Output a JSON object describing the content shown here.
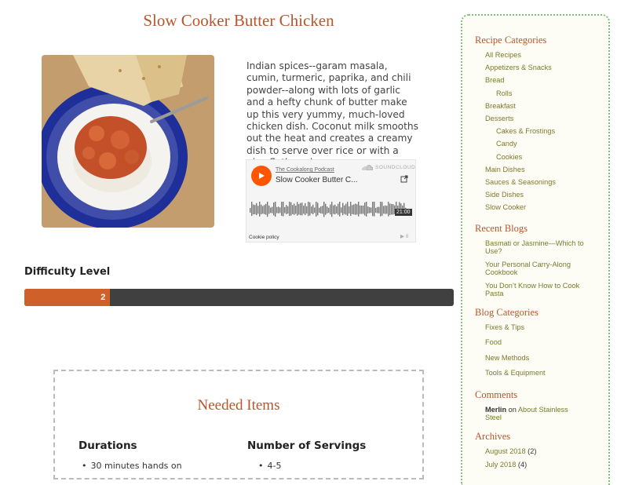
{
  "recipe": {
    "title": "Slow Cooker Butter Chicken",
    "description": "Indian spices--garam masala, cumin, turmeric, paprika, and chili powder--along with lots of garlic and a hefty chunk of butter make up this very yummy, much-loved chicken dish. Coconut milk smooths out the heat and creates a creamy dish to serve over rice or with a nice flatbread."
  },
  "player": {
    "artist": "The Cookalong Podcast",
    "track": "Slow Cooker Butter C...",
    "brand": "SOUNDCLOUD",
    "duration": "21:00",
    "cookie_policy": "Cookie policy",
    "stats": "8",
    "accent_color": "#ff5500"
  },
  "difficulty": {
    "label": "Difficulty Level",
    "value": "2",
    "fraction": 0.2,
    "fill_color": "#d0602a"
  },
  "needed": {
    "title": "Needed Items",
    "durations_heading": "Durations",
    "durations": [
      "30 minutes hands on"
    ],
    "servings_heading": "Number of Servings",
    "servings": [
      "4-5"
    ]
  },
  "sidebar": {
    "recipe_categories_heading": "Recipe Categories",
    "recipe_categories": [
      {
        "label": "All Recipes",
        "indent": 0
      },
      {
        "label": "Appetizers & Snacks",
        "indent": 0
      },
      {
        "label": "Bread",
        "indent": 0
      },
      {
        "label": "Rolls",
        "indent": 1
      },
      {
        "label": "Breakfast",
        "indent": 0
      },
      {
        "label": "Desserts",
        "indent": 0
      },
      {
        "label": "Cakes & Frostings",
        "indent": 1
      },
      {
        "label": "Candy",
        "indent": 1
      },
      {
        "label": "Cookies",
        "indent": 1
      },
      {
        "label": "Main Dishes",
        "indent": 0
      },
      {
        "label": "Sauces & Seasonings",
        "indent": 0
      },
      {
        "label": "Side Dishes",
        "indent": 0
      },
      {
        "label": "Slow Cooker",
        "indent": 0
      }
    ],
    "recent_blogs_heading": "Recent Blogs",
    "recent_blogs": [
      [
        "Basmati or Jasmine—Which to",
        "Use?"
      ],
      [
        "Your Personal Carry-Along",
        "Cookbook"
      ],
      [
        "You Don’t Know How to Cook",
        "Pasta"
      ]
    ],
    "blog_categories_heading": "Blog Categories",
    "blog_categories": [
      "Fixes & Tips",
      "Food",
      "New Methods",
      "Tools & Equipment"
    ],
    "comments_heading": "Comments",
    "comment": {
      "author": "Merlin",
      "on": "on",
      "post_line1": "About Stainless",
      "post_line2": "Steel"
    },
    "archives_heading": "Archives",
    "archives": [
      {
        "label": "August 2018",
        "count": "(2)"
      },
      {
        "label": "July 2018",
        "count": "(4)"
      }
    ],
    "link_color": "#7a7a2e",
    "heading_color": "#b5562d"
  }
}
